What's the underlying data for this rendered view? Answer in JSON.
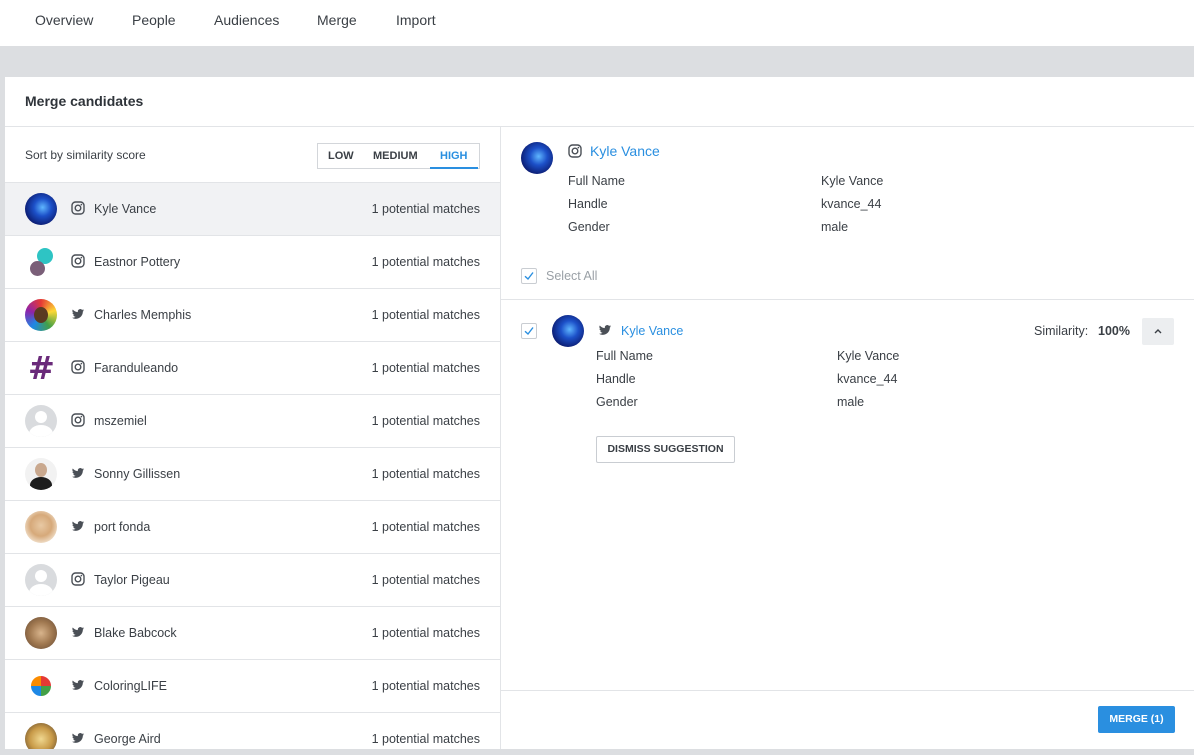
{
  "nav": {
    "tabs": [
      "Overview",
      "People",
      "Audiences",
      "Merge",
      "Import"
    ]
  },
  "panel": {
    "title": "Merge candidates"
  },
  "sort": {
    "label": "Sort by similarity score",
    "options": [
      "LOW",
      "MEDIUM",
      "HIGH"
    ],
    "selected": "HIGH"
  },
  "candidates": [
    {
      "name": "Kyle Vance",
      "network": "instagram-icon",
      "matches": "1 potential matches"
    },
    {
      "name": "Eastnor Pottery",
      "network": "instagram-icon",
      "matches": "1 potential matches"
    },
    {
      "name": "Charles Memphis",
      "network": "twitter-icon",
      "matches": "1 potential matches"
    },
    {
      "name": "Faranduleando",
      "network": "instagram-icon",
      "matches": "1 potential matches"
    },
    {
      "name": "mszemiel",
      "network": "instagram-icon",
      "matches": "1 potential matches"
    },
    {
      "name": "Sonny Gillissen",
      "network": "twitter-icon",
      "matches": "1 potential matches"
    },
    {
      "name": "port fonda",
      "network": "twitter-icon",
      "matches": "1 potential matches"
    },
    {
      "name": "Taylor Pigeau",
      "network": "instagram-icon",
      "matches": "1 potential matches"
    },
    {
      "name": "Blake Babcock",
      "network": "twitter-icon",
      "matches": "1 potential matches"
    },
    {
      "name": "ColoringLIFE",
      "network": "twitter-icon",
      "matches": "1 potential matches"
    },
    {
      "name": "George Aird",
      "network": "twitter-icon",
      "matches": "1 potential matches"
    }
  ],
  "primary": {
    "name": "Kyle Vance",
    "network": "instagram-icon",
    "fields": [
      {
        "label": "Full Name",
        "value": "Kyle Vance"
      },
      {
        "label": "Handle",
        "value": "kvance_44"
      },
      {
        "label": "Gender",
        "value": "male"
      }
    ]
  },
  "select_all": {
    "label": "Select All",
    "checked": true
  },
  "match": {
    "name": "Kyle Vance",
    "network": "twitter-icon",
    "checked": true,
    "similarity_label": "Similarity:",
    "similarity_value": "100%",
    "fields": [
      {
        "label": "Full Name",
        "value": "Kyle Vance"
      },
      {
        "label": "Handle",
        "value": "kvance_44"
      },
      {
        "label": "Gender",
        "value": "male"
      }
    ],
    "dismiss_label": "DISMISS SUGGESTION"
  },
  "merge_button": {
    "label": "MERGE (1)"
  },
  "colors": {
    "accent": "#2a8fe0",
    "selected_row": "#f1f2f4",
    "background": "#dcdee1"
  }
}
